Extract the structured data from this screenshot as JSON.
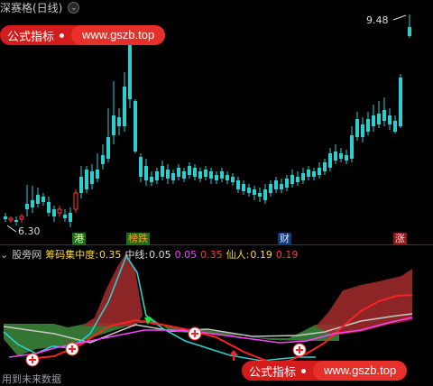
{
  "header": {
    "title": "深赛格(日线)",
    "dropdown_icon": "chevron-down-icon"
  },
  "watermark": {
    "label": "公式指标",
    "url": "www.gszb.top"
  },
  "price": {
    "high": "9.48",
    "low": "6.30"
  },
  "tags": {
    "gang": "港",
    "bangdie": "榜跌",
    "cai": "财",
    "zhang": "涨"
  },
  "indicator": {
    "name": "股旁网",
    "chouma_label": "筹码集中度:",
    "chouma_value": "0.35",
    "zhongxian_label": "中线:",
    "zhongxian_v1": "0.05",
    "zhongxian_v2": "0.05",
    "zhongxian_v3": "0.35",
    "xianren_label": "仙人:",
    "xianren_v1": "0.19",
    "xianren_v2": "0.19"
  },
  "footer": {
    "text": "用到未来数据"
  },
  "colors": {
    "up": "#ff3b3b",
    "down": "#00e5e5",
    "green": "#36b24a",
    "magenta": "#ff40ff",
    "yellow": "#ffd84a"
  }
}
